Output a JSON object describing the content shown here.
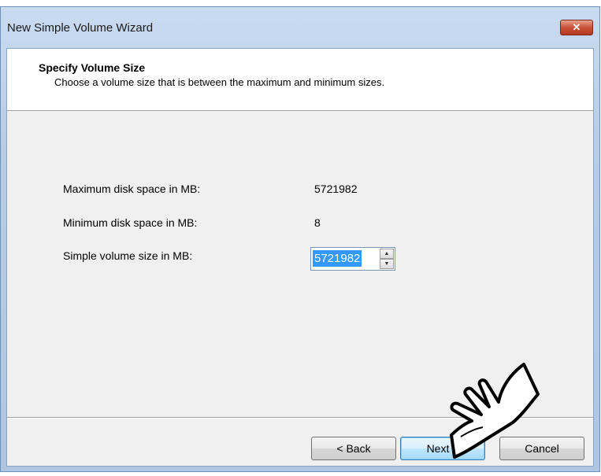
{
  "window": {
    "title": "New Simple Volume Wizard",
    "close_symbol": "✕"
  },
  "header": {
    "title": "Specify Volume Size",
    "subtitle": "Choose a volume size that is between the maximum and minimum sizes."
  },
  "fields": {
    "max_label": "Maximum disk space in MB:",
    "max_value": "5721982",
    "min_label": "Minimum disk space in MB:",
    "min_value": "8",
    "size_label": "Simple volume size in MB:",
    "size_value": "5721982"
  },
  "buttons": {
    "back": "< Back",
    "next": "Next >",
    "cancel": "Cancel"
  },
  "icons": {
    "close": "close-icon",
    "spin_up": "spin-up-arrow-icon",
    "spin_down": "spin-down-arrow-icon",
    "pointer": "pointing-hand-icon"
  },
  "colors": {
    "selection": "#3399ff",
    "close_button": "#c95037",
    "default_button": "#a7d9f5"
  }
}
